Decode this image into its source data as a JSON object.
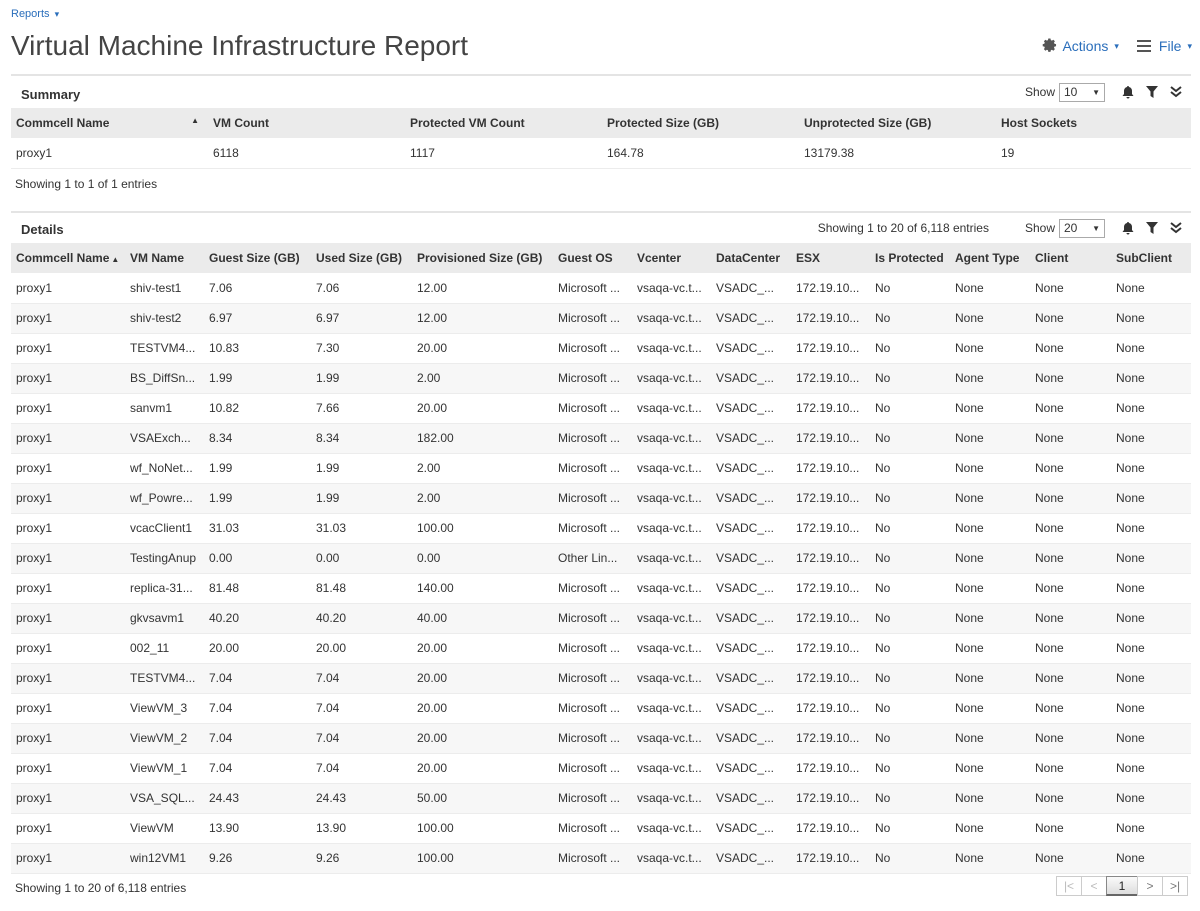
{
  "breadcrumb": {
    "label": "Reports",
    "caret": "▾"
  },
  "title": "Virtual Machine Infrastructure Report",
  "top_actions": {
    "actions_label": "Actions",
    "file_label": "File",
    "caret": "▾"
  },
  "icons": {
    "bell": "bell-icon",
    "filter": "filter-icon",
    "expand": "double-chevron-down-icon",
    "sort_asc": "▲"
  },
  "summary": {
    "title": "Summary",
    "show_label": "Show",
    "show_value": "10",
    "columns": [
      "Commcell Name",
      "VM Count",
      "Protected VM Count",
      "Protected Size (GB)",
      "Unprotected Size (GB)",
      "Host Sockets"
    ],
    "rows": [
      [
        "proxy1",
        "6118",
        "1117",
        "164.78",
        "13179.38",
        "19"
      ]
    ],
    "footer": "Showing 1 to 1 of 1 entries"
  },
  "details": {
    "title": "Details",
    "showing": "Showing 1 to 20 of 6,118 entries",
    "show_label": "Show",
    "show_value": "20",
    "columns": [
      "Commcell Name",
      "VM Name",
      "Guest Size (GB)",
      "Used Size (GB)",
      "Provisioned Size (GB)",
      "Guest OS",
      "Vcenter",
      "DataCenter",
      "ESX",
      "Is Protected",
      "Agent Type",
      "Client",
      "SubClient"
    ],
    "rows": [
      [
        "proxy1",
        "shiv-test1",
        "7.06",
        "7.06",
        "12.00",
        "Microsoft ...",
        "vsaqa-vc.t...",
        "VSADC_...",
        "172.19.10...",
        "No",
        "None",
        "None",
        "None"
      ],
      [
        "proxy1",
        "shiv-test2",
        "6.97",
        "6.97",
        "12.00",
        "Microsoft ...",
        "vsaqa-vc.t...",
        "VSADC_...",
        "172.19.10...",
        "No",
        "None",
        "None",
        "None"
      ],
      [
        "proxy1",
        "TESTVM4...",
        "10.83",
        "7.30",
        "20.00",
        "Microsoft ...",
        "vsaqa-vc.t...",
        "VSADC_...",
        "172.19.10...",
        "No",
        "None",
        "None",
        "None"
      ],
      [
        "proxy1",
        "BS_DiffSn...",
        "1.99",
        "1.99",
        "2.00",
        "Microsoft ...",
        "vsaqa-vc.t...",
        "VSADC_...",
        "172.19.10...",
        "No",
        "None",
        "None",
        "None"
      ],
      [
        "proxy1",
        "sanvm1",
        "10.82",
        "7.66",
        "20.00",
        "Microsoft ...",
        "vsaqa-vc.t...",
        "VSADC_...",
        "172.19.10...",
        "No",
        "None",
        "None",
        "None"
      ],
      [
        "proxy1",
        "VSAExch...",
        "8.34",
        "8.34",
        "182.00",
        "Microsoft ...",
        "vsaqa-vc.t...",
        "VSADC_...",
        "172.19.10...",
        "No",
        "None",
        "None",
        "None"
      ],
      [
        "proxy1",
        "wf_NoNet...",
        "1.99",
        "1.99",
        "2.00",
        "Microsoft ...",
        "vsaqa-vc.t...",
        "VSADC_...",
        "172.19.10...",
        "No",
        "None",
        "None",
        "None"
      ],
      [
        "proxy1",
        "wf_Powre...",
        "1.99",
        "1.99",
        "2.00",
        "Microsoft ...",
        "vsaqa-vc.t...",
        "VSADC_...",
        "172.19.10...",
        "No",
        "None",
        "None",
        "None"
      ],
      [
        "proxy1",
        "vcacClient1",
        "31.03",
        "31.03",
        "100.00",
        "Microsoft ...",
        "vsaqa-vc.t...",
        "VSADC_...",
        "172.19.10...",
        "No",
        "None",
        "None",
        "None"
      ],
      [
        "proxy1",
        "TestingAnup",
        "0.00",
        "0.00",
        "0.00",
        "Other Lin...",
        "vsaqa-vc.t...",
        "VSADC_...",
        "172.19.10...",
        "No",
        "None",
        "None",
        "None"
      ],
      [
        "proxy1",
        "replica-31...",
        "81.48",
        "81.48",
        "140.00",
        "Microsoft ...",
        "vsaqa-vc.t...",
        "VSADC_...",
        "172.19.10...",
        "No",
        "None",
        "None",
        "None"
      ],
      [
        "proxy1",
        "gkvsavm1",
        "40.20",
        "40.20",
        "40.00",
        "Microsoft ...",
        "vsaqa-vc.t...",
        "VSADC_...",
        "172.19.10...",
        "No",
        "None",
        "None",
        "None"
      ],
      [
        "proxy1",
        "002_11",
        "20.00",
        "20.00",
        "20.00",
        "Microsoft ...",
        "vsaqa-vc.t...",
        "VSADC_...",
        "172.19.10...",
        "No",
        "None",
        "None",
        "None"
      ],
      [
        "proxy1",
        "TESTVM4...",
        "7.04",
        "7.04",
        "20.00",
        "Microsoft ...",
        "vsaqa-vc.t...",
        "VSADC_...",
        "172.19.10...",
        "No",
        "None",
        "None",
        "None"
      ],
      [
        "proxy1",
        "ViewVM_3",
        "7.04",
        "7.04",
        "20.00",
        "Microsoft ...",
        "vsaqa-vc.t...",
        "VSADC_...",
        "172.19.10...",
        "No",
        "None",
        "None",
        "None"
      ],
      [
        "proxy1",
        "ViewVM_2",
        "7.04",
        "7.04",
        "20.00",
        "Microsoft ...",
        "vsaqa-vc.t...",
        "VSADC_...",
        "172.19.10...",
        "No",
        "None",
        "None",
        "None"
      ],
      [
        "proxy1",
        "ViewVM_1",
        "7.04",
        "7.04",
        "20.00",
        "Microsoft ...",
        "vsaqa-vc.t...",
        "VSADC_...",
        "172.19.10...",
        "No",
        "None",
        "None",
        "None"
      ],
      [
        "proxy1",
        "VSA_SQL...",
        "24.43",
        "24.43",
        "50.00",
        "Microsoft ...",
        "vsaqa-vc.t...",
        "VSADC_...",
        "172.19.10...",
        "No",
        "None",
        "None",
        "None"
      ],
      [
        "proxy1",
        "ViewVM",
        "13.90",
        "13.90",
        "100.00",
        "Microsoft ...",
        "vsaqa-vc.t...",
        "VSADC_...",
        "172.19.10...",
        "No",
        "None",
        "None",
        "None"
      ],
      [
        "proxy1",
        "win12VM1",
        "9.26",
        "9.26",
        "100.00",
        "Microsoft ...",
        "vsaqa-vc.t...",
        "VSADC_...",
        "172.19.10...",
        "No",
        "None",
        "None",
        "None"
      ]
    ],
    "footer": "Showing 1 to 20 of 6,118 entries"
  },
  "pager": {
    "first": "|<",
    "prev": "<",
    "current": "1",
    "next": ">",
    "last": ">|"
  }
}
